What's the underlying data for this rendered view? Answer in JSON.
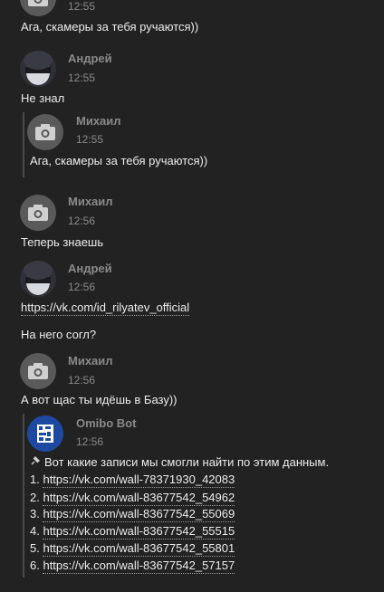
{
  "messages": [
    {
      "time": "12:55",
      "text": "Ага, скамеры за тебя ручаются))"
    },
    {
      "author": "Андрей",
      "time": "12:55",
      "text": "Не знал",
      "quote": {
        "author": "Михаил",
        "time": "12:55",
        "text": "Ага, скамеры за тебя ручаются))"
      }
    },
    {
      "author": "Михаил",
      "time": "12:56",
      "text": "Теперь знаешь"
    },
    {
      "author": "Андрей",
      "time": "12:56",
      "link": "https://vk.com/id_rilyatev_official",
      "text2": "На него согл?"
    },
    {
      "author": "Михаил",
      "time": "12:56",
      "text": "А вот щас ты идёшь в Базу))",
      "bot_quote": {
        "author": "Omibo Bot",
        "time": "12:56",
        "intro": "Вот какие записи мы смогли найти по этим данным.",
        "items": [
          {
            "num": "1.",
            "url": "https://vk.com/wall-78371930_42083"
          },
          {
            "num": "2.",
            "url": "https://vk.com/wall-83677542_54962"
          },
          {
            "num": "3.",
            "url": "https://vk.com/wall-83677542_55069"
          },
          {
            "num": "4.",
            "url": "https://vk.com/wall-83677542_55515"
          },
          {
            "num": "5.",
            "url": "https://vk.com/wall-83677542_55801"
          },
          {
            "num": "6.",
            "url": "https://vk.com/wall-83677542_57157"
          }
        ]
      }
    }
  ],
  "colors": {
    "background": "#222222",
    "muted": "#8a8a8a",
    "text": "#ececec",
    "quote_bar": "#4a4a4a"
  },
  "icons": {
    "default_avatar": "camera-icon",
    "bot_intro": "pin-icon"
  }
}
